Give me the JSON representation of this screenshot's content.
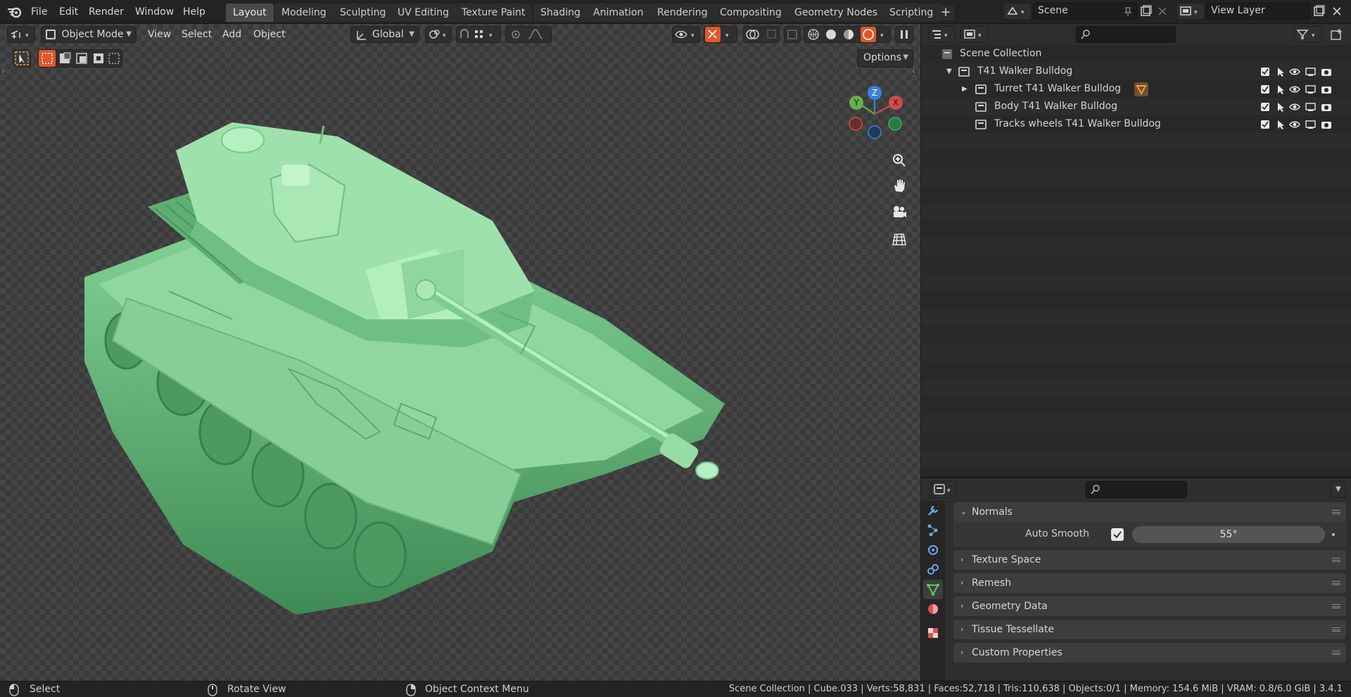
{
  "menubar": {
    "items": [
      "File",
      "Edit",
      "Render",
      "Window",
      "Help"
    ]
  },
  "workspaces": {
    "tabs": [
      "Layout",
      "Modeling",
      "Sculpting",
      "UV Editing",
      "Texture Paint",
      "Shading",
      "Animation",
      "Rendering",
      "Compositing",
      "Geometry Nodes",
      "Scripting"
    ],
    "active": "Layout",
    "add_label": "+"
  },
  "scene": {
    "label": "Scene",
    "view_layer_label": "View Layer"
  },
  "viewport": {
    "mode": "Object Mode",
    "menus": [
      "View",
      "Select",
      "Add",
      "Object"
    ],
    "orientation": "Global",
    "options_label": "Options",
    "gizmo": {
      "z": "Z",
      "y": "Y",
      "x": "X"
    },
    "model_color": "#8fd6a0"
  },
  "outliner": {
    "root": "Scene Collection",
    "collection": "T41 Walker Bulldog",
    "children": [
      "Turret T41 Walker Bulldog",
      "Body T41 Walker Bulldog",
      "Tracks wheels T41 Walker Bulldog"
    ]
  },
  "properties": {
    "panels": {
      "normals": "Normals",
      "auto_smooth_label": "Auto Smooth",
      "auto_smooth_angle": "55°",
      "texture_space": "Texture Space",
      "remesh": "Remesh",
      "geometry_data": "Geometry Data",
      "tissue": "Tissue Tessellate",
      "custom": "Custom Properties"
    }
  },
  "status": {
    "select": "Select",
    "rotate": "Rotate View",
    "context": "Object Context Menu",
    "stats": "Scene Collection | Cube.033 | Verts:58,831 | Faces:52,718 | Tris:110,638 | Objects:0/1 | Memory: 154.6 MiB | VRAM: 0.8/6.0 GiB | 3.4.1"
  },
  "colors": {
    "accent": "#e2572a",
    "active_tab": "#4a4a4a",
    "bg": "#232323"
  }
}
